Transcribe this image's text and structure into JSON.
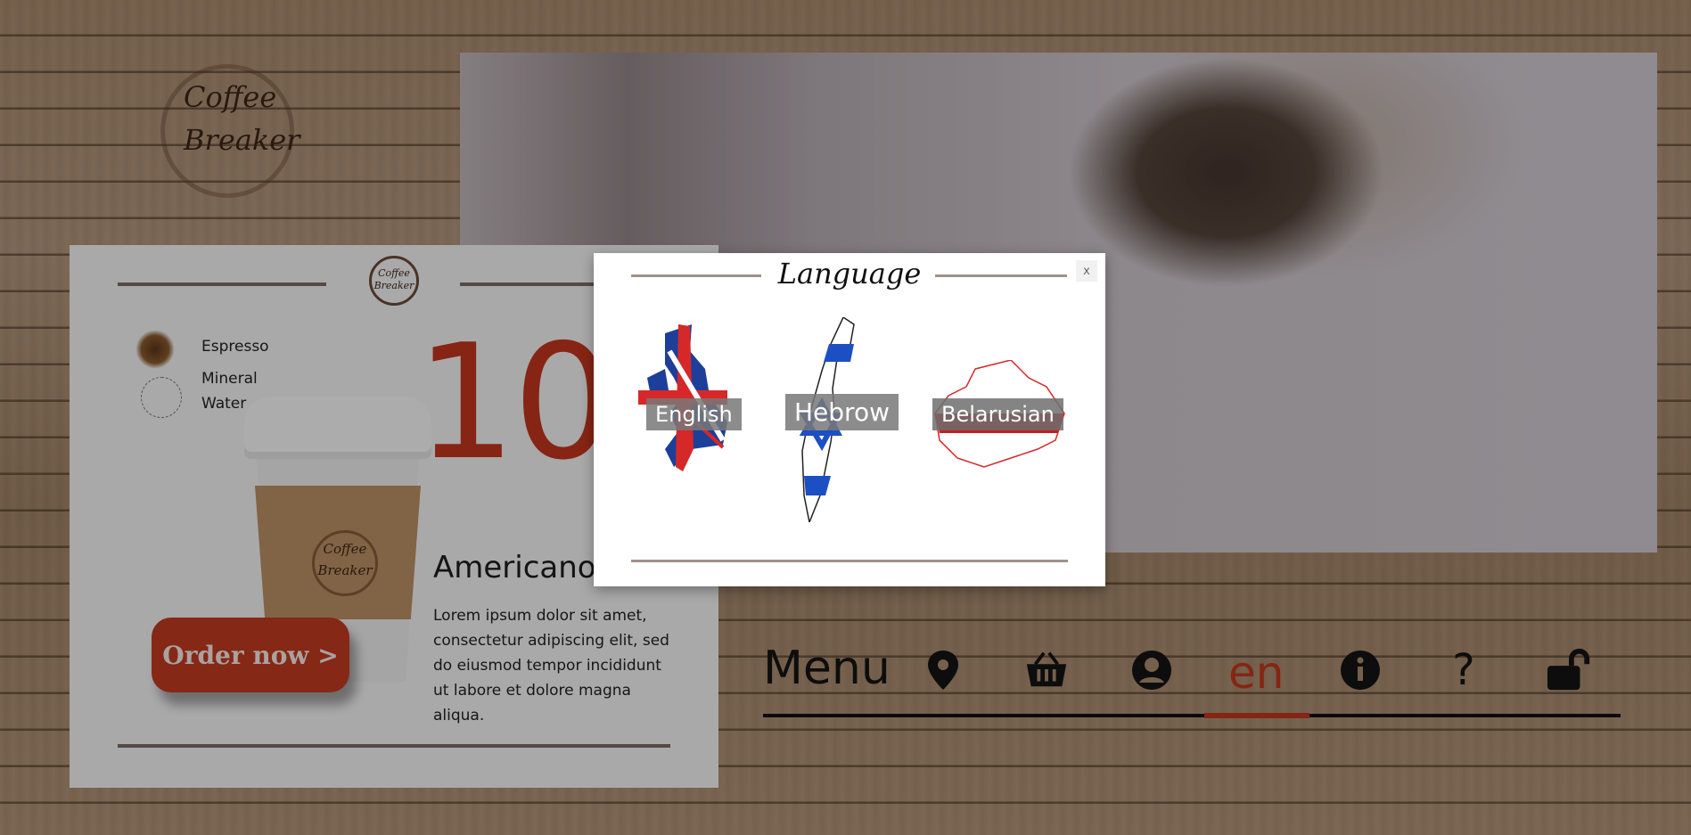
{
  "logo": {
    "line1": "Coffee",
    "line2": "Breaker"
  },
  "card": {
    "mini_logo_line1": "Coffee",
    "mini_logo_line2": "Breaker",
    "ingredients": [
      {
        "label": "Espresso",
        "icon": "espresso-icon"
      },
      {
        "label": "Mineral",
        "label2": "Water",
        "icon": "water-icon"
      }
    ],
    "price": "10",
    "cup_logo_line1": "Coffee",
    "cup_logo_line2": "Breaker",
    "title": "Americano",
    "description": "Lorem ipsum dolor sit amet, consectetur adipiscing elit, sed do eiusmod tempor incididunt ut labore et dolore magna aliqua.",
    "order_label": "Order now >"
  },
  "nav": {
    "menu_label": "Menu",
    "items": [
      {
        "icon": "location-pin-icon"
      },
      {
        "icon": "basket-icon"
      },
      {
        "icon": "user-icon"
      },
      {
        "label": "en",
        "active": true
      },
      {
        "icon": "info-icon"
      },
      {
        "label": "?",
        "icon": "question-icon"
      },
      {
        "icon": "unlock-icon"
      }
    ],
    "accent_color": "#c0361d"
  },
  "modal": {
    "title": "Language",
    "close_label": "x",
    "languages": [
      {
        "label": "English",
        "flag": "uk-flag-map"
      },
      {
        "label": "Hebrow",
        "flag": "israel-flag-map"
      },
      {
        "label": "Belarusian",
        "flag": "belarus-flag-map"
      }
    ]
  }
}
